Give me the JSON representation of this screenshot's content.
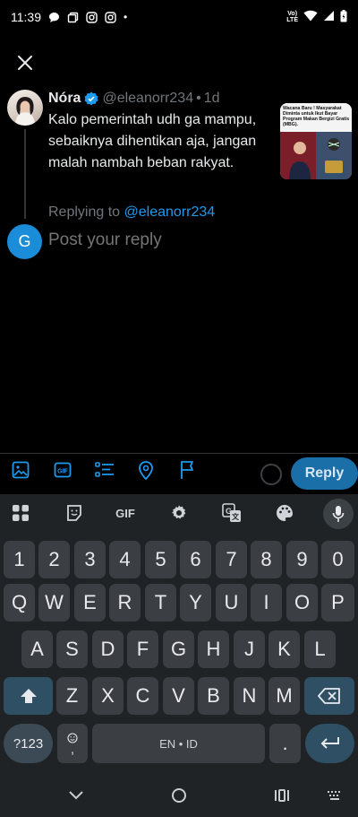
{
  "status_bar": {
    "time": "11:39",
    "network_label": "Vo)\nLTE",
    "dot": "•"
  },
  "tweet": {
    "author_name": "Nóra",
    "handle": "@eleanorr234",
    "separator": "•",
    "age": "1d",
    "text": "Kalo pemerintah udh ga mampu, sebaiknya dihentikan aja, jangan malah nambah beban rakyat.",
    "thumbnail_caption": "Wacana Baru ! Masyarakat Diminta untuk Ikut Bayar Program Makan Bergizi Gratis (MBG)."
  },
  "replying": {
    "prefix": "Replying to",
    "mention": "@eleanorr234"
  },
  "composer": {
    "avatar_letter": "G",
    "placeholder": "Post your reply",
    "reply_label": "Reply"
  },
  "keyboard": {
    "gif_label": "GIF",
    "row_numbers": [
      "1",
      "2",
      "3",
      "4",
      "5",
      "6",
      "7",
      "8",
      "9",
      "0"
    ],
    "row_1": [
      "Q",
      "W",
      "E",
      "R",
      "T",
      "Y",
      "U",
      "I",
      "O",
      "P"
    ],
    "row_2": [
      "A",
      "S",
      "D",
      "F",
      "G",
      "H",
      "J",
      "K",
      "L"
    ],
    "row_3": [
      "Z",
      "X",
      "C",
      "V",
      "B",
      "N",
      "M"
    ],
    "symbols_label": "?123",
    "comma_label": ",",
    "space_label": "EN • ID",
    "period_label": "."
  },
  "colors": {
    "accent": "#1d9bf0",
    "reply_button": "#1a6fa8",
    "keyboard_bg": "#1f2326",
    "key_bg": "#3b3f43"
  }
}
